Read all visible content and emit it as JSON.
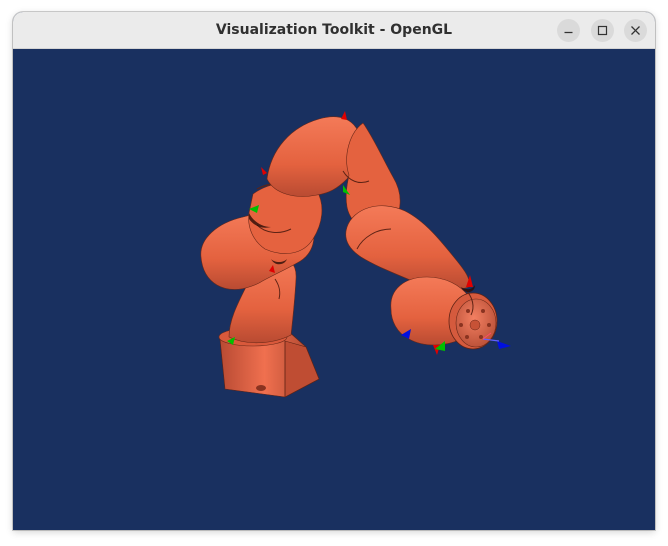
{
  "window": {
    "title": "Visualization Toolkit - OpenGL",
    "background_color": "#193060"
  },
  "controls": {
    "minimize_icon": "minimize-icon",
    "maximize_icon": "maximize-icon",
    "close_icon": "close-icon"
  },
  "scene": {
    "model_color": "#e8664a",
    "axis_colors": {
      "x": "#e00000",
      "y": "#00c000",
      "z": "#0010e0"
    }
  }
}
